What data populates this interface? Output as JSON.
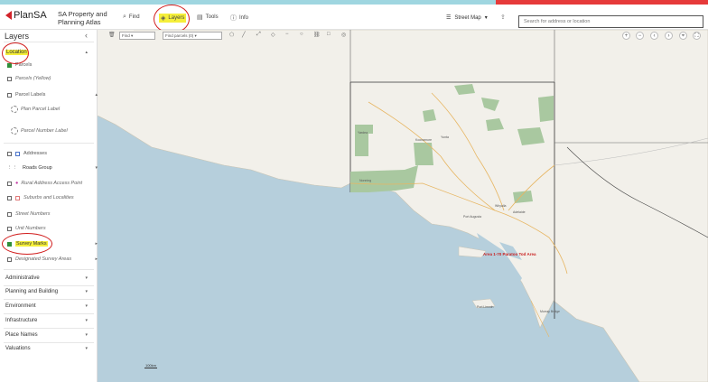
{
  "app": {
    "logo": "PlanSA",
    "title": "SA Property and Planning Atlas"
  },
  "nav": {
    "find": "Find",
    "layers": "Layers",
    "tools": "Tools",
    "info": "Info",
    "basemap": "Street Map",
    "search_placeholder": "Search for address or location"
  },
  "toolbar": {
    "mode": "Find",
    "parcels": "Find parcels (0)"
  },
  "sidebar": {
    "title": "Layers",
    "location_section": "Location",
    "items": [
      {
        "label": "Parcels",
        "checked": true
      },
      {
        "label": "Parcels (Yellow)",
        "checked": false
      },
      {
        "label": "Parcel Labels",
        "checked": false
      },
      {
        "label": "Plan Parcel Label",
        "checked": false
      },
      {
        "label": "Parcel Number Label",
        "checked": false
      },
      {
        "label": "Addresses",
        "checked": false
      },
      {
        "label": "Roads Group",
        "checked": false
      },
      {
        "label": "Rural Address Access Point",
        "checked": false
      },
      {
        "label": "Suburbs and Localities",
        "checked": false
      },
      {
        "label": "Street Numbers",
        "checked": false
      },
      {
        "label": "Unit Numbers",
        "checked": false
      },
      {
        "label": "Survey Marks",
        "checked": true
      },
      {
        "label": "Designated Survey Areas",
        "checked": false
      }
    ],
    "sections": [
      "Administrative",
      "Planning and Building",
      "Environment",
      "Infrastructure",
      "Place Names",
      "Valuations"
    ]
  },
  "map": {
    "designated_area_label": "Area 1-70 Paratoo Tod Area",
    "scale": "100km",
    "region_labels": [
      "Koonamore",
      "Yunta",
      "Nonning",
      "Yardea",
      "Whyalla",
      "Port Augusta",
      "Port Lincoln",
      "Adelaide",
      "Murray Bridge"
    ]
  },
  "colors": {
    "accent_red": "#d2232a",
    "highlight_yellow": "#f5ef3a",
    "sea": "#b6cfdc",
    "land": "#f2f0ea",
    "park": "#a9c8a0"
  }
}
